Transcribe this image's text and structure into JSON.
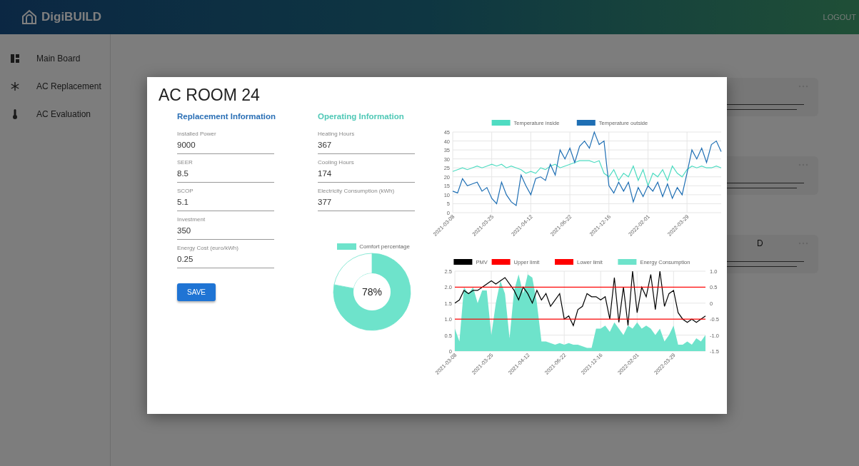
{
  "header": {
    "logo": "DigiBUILD",
    "logout": "LOGOUT"
  },
  "sidebar": {
    "items": [
      {
        "label": "Main Board"
      },
      {
        "label": "AC Replacement"
      },
      {
        "label": "AC Evaluation"
      }
    ]
  },
  "background_cards": {
    "partial_title": "D"
  },
  "modal": {
    "title": "AC ROOM 24",
    "replacement": {
      "heading": "Replacement Information",
      "fields": [
        {
          "label": "Installed Power",
          "value": "9000"
        },
        {
          "label": "SEER",
          "value": "8.5"
        },
        {
          "label": "SCOP",
          "value": "5.1"
        },
        {
          "label": "Investment",
          "value": "350"
        },
        {
          "label": "Energy Cost (euro/kWh)",
          "value": "0.25"
        }
      ],
      "button": "SAVE"
    },
    "operating": {
      "heading": "Operating Information",
      "fields": [
        {
          "label": "Heating Hours",
          "value": "367"
        },
        {
          "label": "Cooling Hours",
          "value": "174"
        },
        {
          "label": "Electricity Consumption (kWh)",
          "value": "377"
        }
      ]
    },
    "comfort": {
      "chart_data": {
        "type": "donut",
        "categories": [
          "Comfort percentage",
          null
        ],
        "values": [
          78,
          22
        ],
        "colors": [
          "#6ee3cb",
          "#ffffff"
        ],
        "legend": true,
        "annotations": [
          {
            "text": "78%"
          }
        ]
      }
    },
    "temperature": {
      "chart_data": {
        "type": "line",
        "grid": true,
        "legend": true,
        "categories": [
          "2021-03-08",
          null,
          null,
          null,
          null,
          null,
          null,
          null,
          "2021-03-25",
          null,
          null,
          null,
          null,
          null,
          null,
          null,
          "2021-04-12",
          null,
          null,
          null,
          null,
          null,
          null,
          null,
          "2021-06-22",
          null,
          null,
          null,
          null,
          null,
          null,
          null,
          "2021-12-16",
          null,
          null,
          null,
          null,
          null,
          null,
          null,
          "2022-02-01",
          null,
          null,
          null,
          null,
          null,
          null,
          null,
          "2022-03-29",
          null,
          null,
          null,
          null,
          null,
          null,
          null
        ],
        "ylim": [
          0,
          45
        ],
        "yticks": [
          0,
          5,
          10,
          15,
          20,
          25,
          30,
          35,
          40,
          45
        ],
        "series": [
          {
            "name": "Temperature inside",
            "color": "#4fdcc2",
            "values": [
              23,
              24,
              25,
              24,
              25,
              26,
              25,
              26,
              27,
              26,
              27,
              25,
              26,
              25,
              24,
              22,
              23,
              22,
              25,
              24,
              26,
              27,
              25,
              26,
              27,
              28,
              29,
              29,
              29,
              28,
              29,
              22,
              20,
              24,
              18,
              22,
              20,
              26,
              18,
              24,
              15,
              22,
              20,
              24,
              18,
              26,
              22,
              20,
              24,
              26,
              25,
              26,
              25,
              25,
              26,
              25
            ]
          },
          {
            "name": "Temperature outside",
            "color": "#1f6fb4",
            "values": [
              12,
              11,
              19,
              15,
              16,
              17,
              12,
              14,
              8,
              5,
              17,
              10,
              6,
              4,
              21,
              15,
              10,
              19,
              20,
              18,
              27,
              21,
              35,
              30,
              36,
              28,
              37,
              40,
              36,
              45,
              38,
              40,
              15,
              11,
              17,
              12,
              17,
              6,
              14,
              9,
              15,
              12,
              17,
              9,
              16,
              8,
              14,
              10,
              22,
              35,
              30,
              36,
              28,
              38,
              40,
              34
            ]
          }
        ]
      }
    },
    "pmv": {
      "chart_data": {
        "type": "line",
        "grid": true,
        "legend": true,
        "categories": [
          "2021-03-08",
          null,
          null,
          null,
          null,
          null,
          null,
          null,
          "2021-03-25",
          null,
          null,
          null,
          null,
          null,
          null,
          null,
          "2021-04-12",
          null,
          null,
          null,
          null,
          null,
          null,
          null,
          "2021-06-22",
          null,
          null,
          null,
          null,
          null,
          null,
          null,
          "2021-12-16",
          null,
          null,
          null,
          null,
          null,
          null,
          null,
          "2022-02-01",
          null,
          null,
          null,
          null,
          null,
          null,
          null,
          "2022-03-29",
          null,
          null,
          null,
          null,
          null,
          null,
          null
        ],
        "ylim": [
          0,
          2.5
        ],
        "yticks": [
          {
            "value": 0,
            "label": "0"
          },
          {
            "value": 0.5,
            "label": "0.5"
          },
          {
            "value": 1,
            "label": "1.0"
          },
          {
            "value": 1.5,
            "label": "1.5"
          },
          {
            "value": 2,
            "label": "2.0"
          },
          {
            "value": 2.5,
            "label": "2.5"
          }
        ],
        "y2lim": [
          -1.5,
          1
        ],
        "y2ticks": [
          {
            "value": 1,
            "label": "1.0"
          },
          {
            "value": 0.5,
            "label": "0.5"
          },
          {
            "value": 0,
            "label": "0"
          },
          {
            "value": -0.5,
            "label": "-0.5"
          },
          {
            "value": -1,
            "label": "-1.0"
          },
          {
            "value": -1.5,
            "label": "-1.5"
          }
        ],
        "series": [
          {
            "name": "PMV",
            "color": "#000000",
            "type": "line",
            "values": [
              1.5,
              1.6,
              1.9,
              1.8,
              1.9,
              1.9,
              2.0,
              2.1,
              2.2,
              2.1,
              2.2,
              2.3,
              2.1,
              1.9,
              1.6,
              2.0,
              1.8,
              1.5,
              1.9,
              1.6,
              1.8,
              1.4,
              1.6,
              1.8,
              1.0,
              1.1,
              0.8,
              1.3,
              1.4,
              1.8,
              1.7,
              1.7,
              1.6,
              1.7,
              1.0,
              2.3,
              0.9,
              2.0,
              0.8,
              2.5,
              1.2,
              2.0,
              1.7,
              2.4,
              1.3,
              2.5,
              1.4,
              1.8,
              1.9,
              1.2,
              1.0,
              0.9,
              1.0,
              0.9,
              1.0,
              1.1
            ]
          },
          {
            "name": "Energy Consumption",
            "color": "#6ee3cb",
            "type": "area",
            "values": [
              0.7,
              0.3,
              2.0,
              1.8,
              2.0,
              1.5,
              1.9,
              1.9,
              0.5,
              1.5,
              2.2,
              1.8,
              0.4,
              1.9,
              2.4,
              1.8,
              2.4,
              2.3,
              1.5,
              0.3,
              0.3,
              0.25,
              0.2,
              0.25,
              0.2,
              0.25,
              0.2,
              0.2,
              0.15,
              0.1,
              0.1,
              0.7,
              0.7,
              0.8,
              0.6,
              0.9,
              0.7,
              0.5,
              0.8,
              0.7,
              0.9,
              0.7,
              0.8,
              0.7,
              0.5,
              0.7,
              0.3,
              0.5,
              0.8,
              0.2,
              0.2,
              0.3,
              0.2,
              0.4,
              0.3,
              0.5
            ]
          }
        ],
        "ref_lines": [
          {
            "axis": "y",
            "label": "Upper limit",
            "value": 2.0,
            "color": "#ff0000"
          },
          {
            "axis": "y",
            "label": "Lower limit",
            "value": 1.0,
            "color": "#ff0000"
          }
        ]
      }
    }
  }
}
